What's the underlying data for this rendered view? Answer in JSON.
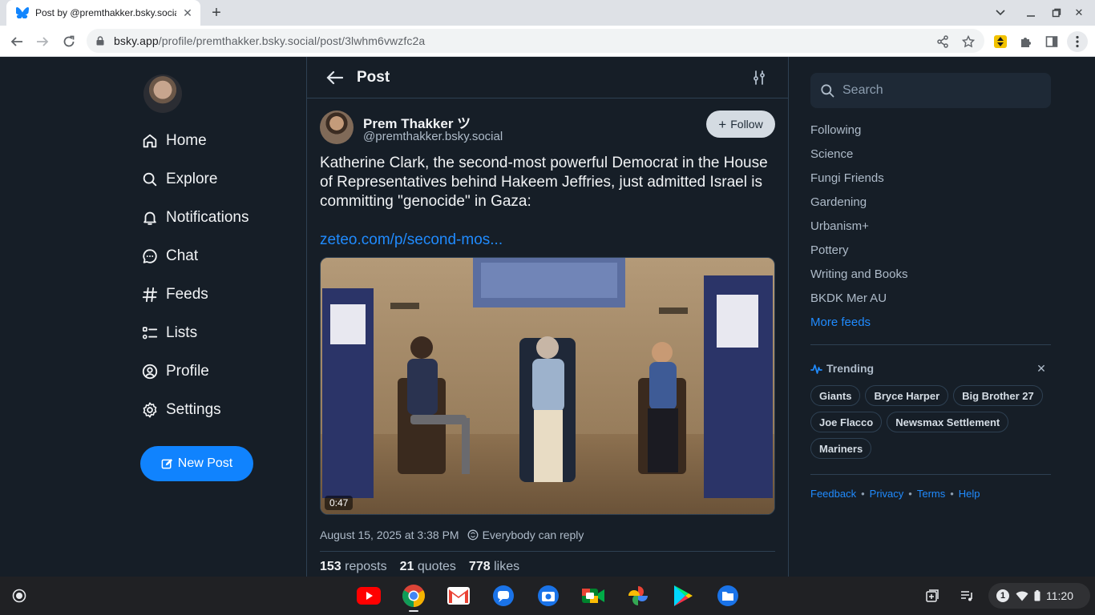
{
  "browser": {
    "tab_title": "Post by @premthakker.bsky.social",
    "url_host": "bsky.app",
    "url_path": "/profile/premthakker.bsky.social/post/3lwhm6vwzfc2a"
  },
  "nav": {
    "items": [
      {
        "label": "Home",
        "icon": "home-icon"
      },
      {
        "label": "Explore",
        "icon": "search-icon"
      },
      {
        "label": "Notifications",
        "icon": "bell-icon"
      },
      {
        "label": "Chat",
        "icon": "chat-icon"
      },
      {
        "label": "Feeds",
        "icon": "hash-icon"
      },
      {
        "label": "Lists",
        "icon": "list-icon"
      },
      {
        "label": "Profile",
        "icon": "user-circle-icon"
      },
      {
        "label": "Settings",
        "icon": "gear-icon"
      }
    ],
    "new_post_label": "New Post"
  },
  "post": {
    "header_title": "Post",
    "author_name": "Prem Thakker ツ",
    "author_handle": "@premthakker.bsky.social",
    "follow_label": "Follow",
    "text": "Katherine Clark, the second-most powerful Democrat in the House of Representatives behind Hakeem Jeffries, just admitted Israel is committing \"genocide\" in Gaza:",
    "link_text": "zeteo.com/p/second-mos...",
    "video_duration": "0:47",
    "timestamp": "August 15, 2025 at 3:38 PM",
    "reply_setting": "Everybody can reply",
    "reposts_count": "153",
    "reposts_label": "reposts",
    "quotes_count": "21",
    "quotes_label": "quotes",
    "likes_count": "778",
    "likes_label": "likes"
  },
  "sidebar": {
    "search_placeholder": "Search",
    "feeds": [
      "Following",
      "Science",
      "Fungi Friends",
      "Gardening",
      "Urbanism+",
      "Pottery",
      "Writing and Books",
      "BKDK Mer AU"
    ],
    "more_feeds_label": "More feeds",
    "trending_title": "Trending",
    "trending": [
      "Giants",
      "Bryce Harper",
      "Big Brother 27",
      "Joe Flacco",
      "Newsmax Settlement",
      "Mariners"
    ],
    "footer": [
      "Feedback",
      "Privacy",
      "Terms",
      "Help"
    ]
  },
  "shelf": {
    "notification_count": "1",
    "time": "11:20"
  },
  "colors": {
    "background": "#161e27",
    "accent": "#1083fe",
    "link": "#208bfe",
    "border": "#2e4052"
  }
}
